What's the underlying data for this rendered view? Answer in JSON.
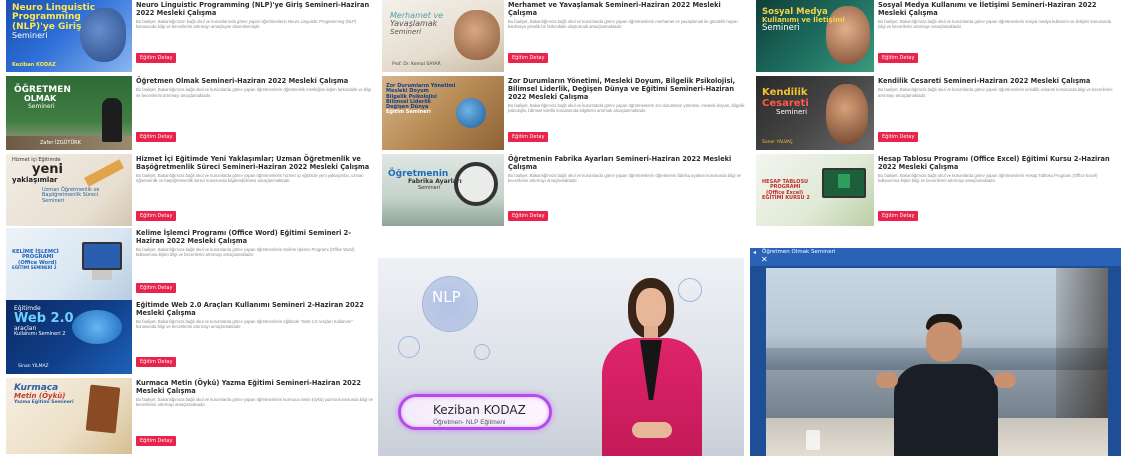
{
  "button_label": "Eğitim Detay",
  "cards": [
    {
      "title": "Neuro Linguistic Programming (NLP)'ye Giriş Semineri-Haziran 2022 Mesleki Çalışma",
      "desc": "Bu faaliyet, Bakanlığımızın bağlı okul ve kurumlarında görev yapan öğretmenlerin Neuro Linguistic Programming (NLP) konusunda bilgi ve becerilerini artırmayı amaçlayan düzenlenmiştir.",
      "thumb_lines": [
        "Neuro Linguistic",
        "Programming",
        "(NLP)'ye Giriş",
        "Semineri"
      ],
      "thumb_author": "Keziban KODAZ"
    },
    {
      "title": "Merhamet ve Yavaşlamak Semineri-Haziran 2022 Mesleki Çalışma",
      "desc": "Bu faaliyet, Bakanlığımıza bağlı okul ve kurumlarda görev yapan öğretmenlerin merhamet ve yavaşlamak ile gündelik hayatı katılmaya yönelik bir farkındalık oluşturmak amaçlanmaktadır.",
      "thumb_lines": [
        "Merhamet ve",
        "Yavaşlamak",
        "Semineri"
      ],
      "thumb_author": "Prof. Dr. Kemal SAYAR"
    },
    {
      "title": "Sosyal Medya Kullanımı ve İletişimi Semineri-Haziran 2022 Mesleki Çalışma",
      "desc": "Bu faaliyet, Bakanlığımıza bağlı okul ve kurumlarda görev yapan öğretmenlerin sosyal medya kullanımı ve iletişimi konusunda bilgi ve becerilerini artırmayı amaçlamaktadır.",
      "thumb_lines": [
        "Sosyal Medya",
        "Kullanımı ve İletişimi",
        "Semineri"
      ],
      "thumb_author": ""
    },
    {
      "title": "Öğretmen Olmak Semineri-Haziran 2022 Mesleki Çalışma",
      "desc": "Bu faaliyet, Bakanlığımıza bağlı okul ve kurumlarda görev yapan öğretmenlerin öğretmenlik mesleğine ilişkin farkındalık ve bilgi ve becerilerini artırmayı amaçlamaktadır.",
      "thumb_lines": [
        "ÖĞRETMEN",
        "OLMAK",
        "Semineri"
      ],
      "thumb_author": "Zafer İZGÜTÜRK"
    },
    {
      "title": "Zor Durumların Yönetimi, Mesleki Doyum, Bilgelik Psikolojisi, Bilimsel Liderlik, Değişen Dünya ve Eğitimi Semineri-Haziran 2022 Mesleki Çalışma",
      "desc": "Bu faaliyet, Bakanlığımıza bağlı okul ve kurumlarda görev yapan öğretmenlerin zor durumların yönetimi, mesleki doyum, bilgelik psikolojisi, bilimsel liderlik konularında bilgilerini artırmak amaçlanmaktadır.",
      "thumb_lines": [
        "Zor Durumların Yönetimi",
        "Mesleki Doyum",
        "Bilgelik Psikolojisi",
        "Bilimsel Liderlik",
        "Değişen Dünya",
        "Eğitim Semineri"
      ],
      "thumb_author": ""
    },
    {
      "title": "Kendilik Cesareti Semineri-Haziran 2022 Mesleki Çalışma",
      "desc": "Bu faaliyet, Bakanlığımıza bağlı okul ve kurumlarda görev yapan öğretmenlerin kendilik cesareti konusunda bilgi ve becerilerini artırmayı amaçlamaktadır.",
      "thumb_lines": [
        "Kendilik",
        "Cesareti",
        "Semineri"
      ],
      "thumb_author": "Soner YALVAÇ"
    },
    {
      "title": "Hizmet İçi Eğitimde Yeni Yaklaşımlar; Uzman Öğretmenlik ve Başöğretmenlik Süreci Semineri-Haziran 2022 Mesleki Çalışma",
      "desc": "Bu faaliyet, Bakanlığımıza bağlı okul ve kurumlarda görev yapan öğretmenlerin hizmet içi eğitimde yeni yaklaşımlar, uzman öğretmenlik ve başöğretmenlik süreci konusunda bilgilendirilmesi amaçlanmaktadır.",
      "thumb_lines": [
        "Hizmet içi Eğitimde",
        "yeni",
        "yaklaşımlar",
        "Uzman Öğretmenlik ve",
        "Başöğretmenlik Süreci",
        "Semineri"
      ],
      "thumb_author": ""
    },
    {
      "title": "Öğretmenin Fabrika Ayarları Semineri-Haziran 2022 Mesleki Çalışma",
      "desc": "Bu faaliyet, Bakanlığımıza bağlı okul ve kurumlarda görev yapan öğretmenlerin öğretmenin fabrika ayarları konusunda bilgi ve becerilerini artırmayı amaçlamaktadır.",
      "thumb_lines": [
        "Öğretmenin",
        "Fabrika Ayarları",
        "Semineri"
      ],
      "thumb_author": ""
    },
    {
      "title": "Hesap Tablosu Programı (Office Excel) Eğitimi Kursu 2-Haziran 2022 Mesleki Çalışma",
      "desc": "Bu faaliyet, Bakanlığımıza bağlı okul ve kurumlarda görev yapan öğretmenlerin Hesap Tablosu Programı (Office Excel) kullanımına ilişkin bilgi ve becerilerini artırmayı amaçlamaktadır.",
      "thumb_lines": [
        "HESAP TABLOSU",
        "PROGRAMI",
        "(Office Excel)",
        "EĞİTİMİ KURSU 2"
      ],
      "thumb_author": ""
    },
    {
      "title": "Kelime İşlemci Programı (Office Word) Eğitimi Semineri 2-Haziran 2022 Mesleki Çalışma",
      "desc": "Bu faaliyet, Bakanlığımıza bağlı okul ve kurumlarda görev yapan öğretmenlerin Kelime İşlemci Programı (Office Word) kullanımına ilişkin bilgi ve becerilerini artırmayı amaçlamaktadır.",
      "thumb_lines": [
        "KELİME İŞLEMCİ",
        "PROGRAMI",
        "(Office Word)",
        "EĞİTİMİ SEMİNERİ 2"
      ],
      "thumb_author": ""
    },
    {
      "title": "Eğitimde Web 2.0 Araçları Kullanımı Semineri 2-Haziran 2022 Mesleki Çalışma",
      "desc": "Bu faaliyet, Bakanlığımıza bağlı okul ve kurumlarda görev yapan öğretmenlerin eğitimde \"Web 2.0 Araçları Kullanımı\" konusunda bilgi ve becerilerini artırmayı amaçlamaktadır.",
      "thumb_lines": [
        "Eğitimde",
        "Web 2.0",
        "araçları",
        "Kullanımı Semineri 2"
      ],
      "thumb_author": "Sinan YILMAZ"
    },
    {
      "title": "Kurmaca Metin (Öykü) Yazma Eğitimi Semineri-Haziran 2022 Mesleki Çalışma",
      "desc": "Bu faaliyet, Bakanlığımıza bağlı okul ve kurumlarda görev yapan öğretmenlerin kurmaca metin (öykü) yazma konusunda bilgi ve becerilerini artırmayı amaçlamaktadır.",
      "thumb_lines": [
        "Kurmaca",
        "Metin (Öykü)",
        "Yazma Eğitimi Semineri"
      ],
      "thumb_author": ""
    }
  ],
  "video_nlp": {
    "logo": "NLP",
    "presenter_name": "Keziban KODAZ",
    "presenter_role": "Öğretmen- NLP Eğitmeni"
  },
  "video_teacher": {
    "title": "Öğretmen Olmak Semineri"
  }
}
